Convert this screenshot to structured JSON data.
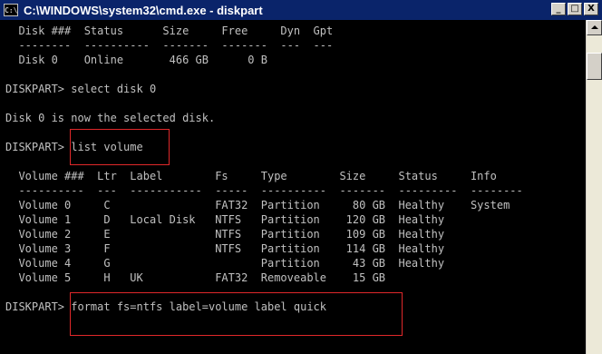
{
  "window": {
    "title": "C:\\WINDOWS\\system32\\cmd.exe - diskpart",
    "icon_label": "C:\\",
    "minimize_label": "_",
    "maximize_label": "□",
    "close_label": "X"
  },
  "console": {
    "lines": [
      "  Disk ###  Status      Size     Free     Dyn  Gpt",
      "  --------  ----------  -------  -------  ---  ---",
      "  Disk 0    Online       466 GB      0 B",
      "",
      "DISKPART> select disk 0",
      "",
      "Disk 0 is now the selected disk.",
      "",
      "DISKPART> list volume",
      "",
      "  Volume ###  Ltr  Label        Fs     Type        Size     Status     Info",
      "  ----------  ---  -----------  -----  ----------  -------  ---------  --------",
      "  Volume 0     C                FAT32  Partition     80 GB  Healthy    System",
      "  Volume 1     D   Local Disk   NTFS   Partition    120 GB  Healthy",
      "  Volume 2     E                NTFS   Partition    109 GB  Healthy",
      "  Volume 3     F                NTFS   Partition    114 GB  Healthy",
      "  Volume 4     G                       Partition     43 GB  Healthy",
      "  Volume 5     H   UK           FAT32  Removeable    15 GB",
      "",
      "DISKPART> format fs=ntfs label=volume label quick"
    ]
  },
  "colors": {
    "titlebar": "#0a246a",
    "console_bg": "#000000",
    "console_text": "#c0c0c0",
    "highlight_box": "#e0282a"
  }
}
